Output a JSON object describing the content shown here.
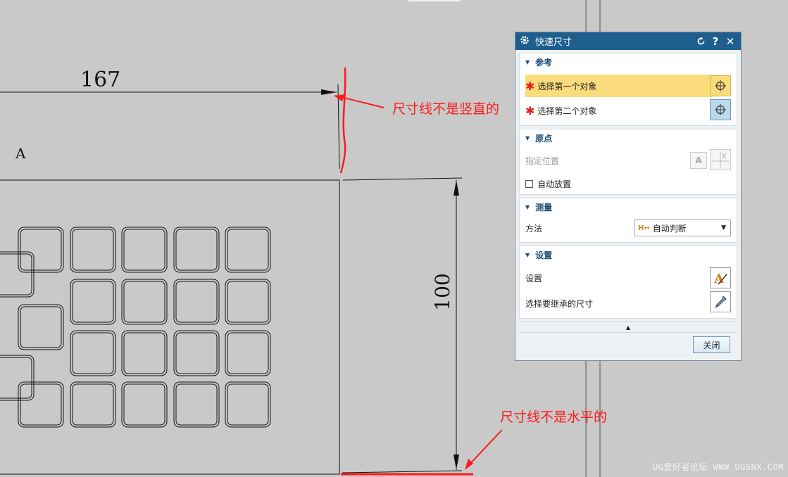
{
  "drawing": {
    "dim_horizontal": "167",
    "dim_vertical": "100",
    "region_label": "A"
  },
  "annotations": {
    "vertical_note": "尺寸线不是竖直的",
    "horizontal_note": "尺寸线不是水平的"
  },
  "watermark": "UG爱好者论坛 WWW.UGSNX.COM",
  "dialog": {
    "title": "快速尺寸",
    "title_icon": "gear-icon",
    "controls": {
      "reset_icon": "reset-icon",
      "help": "?",
      "close": "✕"
    },
    "sections": {
      "reference": {
        "title": "参考",
        "first_object": "选择第一个对象",
        "second_object": "选择第二个对象"
      },
      "origin": {
        "title": "原点",
        "specify_location": "指定位置",
        "auto_place": "自动放置"
      },
      "measure": {
        "title": "测量",
        "method_label": "方法",
        "method_value": "自动判断"
      },
      "settings": {
        "title": "设置",
        "settings_label": "设置",
        "inherit_label": "选择要继承的尺寸"
      }
    },
    "close_button": "关闭"
  },
  "colors": {
    "canvas": "#c9c9c9",
    "title_bar": "#1e5f8e",
    "selection": "#fbdc7c",
    "annotation": "#ff1a1a"
  }
}
